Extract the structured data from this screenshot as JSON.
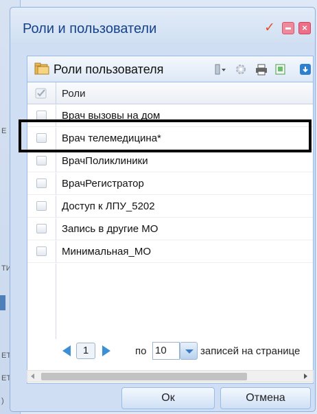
{
  "window": {
    "title": "Роли и пользователи"
  },
  "panel": {
    "title": "Роли пользователя",
    "column_header": "Роли"
  },
  "rows": [
    {
      "label": "Врач вызовы на дом",
      "checked": false
    },
    {
      "label": "Врач телемедицина*",
      "checked": false
    },
    {
      "label": "ВрачПоликлиники",
      "checked": false
    },
    {
      "label": "ВрачРегистратор",
      "checked": false
    },
    {
      "label": "Доступ к ЛПУ_5202",
      "checked": false
    },
    {
      "label": "Запись в другие МО",
      "checked": false
    },
    {
      "label": "Минимальная_МО",
      "checked": false
    }
  ],
  "pager": {
    "page": "1",
    "po_label": "по",
    "per_page": "10",
    "records_label": "записей на странице"
  },
  "buttons": {
    "ok": "Ок",
    "cancel": "Отмена"
  },
  "colors": {
    "title_text": "#15428b",
    "highlight_border": "#000000",
    "nav_arrow": "#3a8fd6"
  }
}
